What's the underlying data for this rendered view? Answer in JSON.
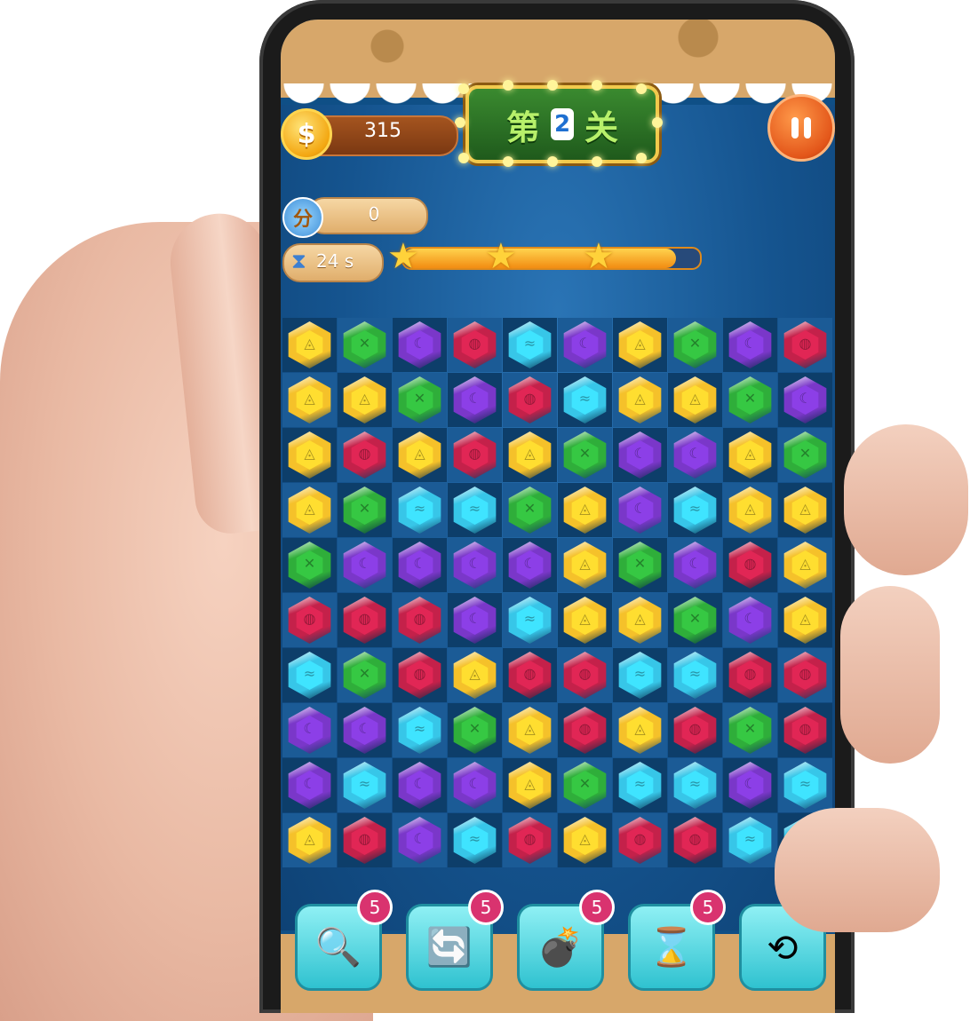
{
  "level": {
    "prefix": "第",
    "number": "2",
    "suffix": "关"
  },
  "coins": {
    "icon": "dollar-coin-icon",
    "symbol": "$",
    "value": "315"
  },
  "pause": {
    "icon": "pause-icon"
  },
  "score": {
    "icon_text": "分",
    "value": "0"
  },
  "timer": {
    "icon": "hourglass-icon",
    "value": "24 s"
  },
  "progress": {
    "fraction": 0.92,
    "star_count": 3
  },
  "board": {
    "rows": 10,
    "cols": 10,
    "gems": [
      [
        "yellow",
        "green",
        "purple",
        "red",
        "cyan",
        "purple",
        "yellow",
        "green",
        "purple",
        "red"
      ],
      [
        "yellow",
        "yellow",
        "green",
        "purple",
        "red",
        "cyan",
        "yellow",
        "yellow",
        "green",
        "purple"
      ],
      [
        "yellow",
        "red",
        "yellow",
        "red",
        "yellow",
        "green",
        "purple",
        "purple",
        "yellow",
        "green"
      ],
      [
        "yellow",
        "green",
        "cyan",
        "cyan",
        "green",
        "yellow",
        "purple",
        "cyan",
        "yellow",
        "yellow"
      ],
      [
        "green",
        "purple",
        "purple",
        "purple",
        "purple",
        "yellow",
        "green",
        "purple",
        "red",
        "yellow"
      ],
      [
        "red",
        "red",
        "red",
        "purple",
        "cyan",
        "yellow",
        "yellow",
        "green",
        "purple",
        "yellow"
      ],
      [
        "cyan",
        "green",
        "red",
        "yellow",
        "red",
        "red",
        "cyan",
        "cyan",
        "red",
        "red"
      ],
      [
        "purple",
        "purple",
        "cyan",
        "green",
        "yellow",
        "red",
        "yellow",
        "red",
        "green",
        "red"
      ],
      [
        "purple",
        "cyan",
        "purple",
        "purple",
        "yellow",
        "green",
        "cyan",
        "cyan",
        "purple",
        "cyan"
      ],
      [
        "yellow",
        "red",
        "purple",
        "cyan",
        "red",
        "yellow",
        "red",
        "red",
        "cyan",
        "cyan"
      ]
    ],
    "colors": {
      "yellow": "#f5c12a",
      "green": "#2fae3a",
      "purple": "#7a37c9",
      "red": "#c4214a",
      "cyan": "#37c6e8"
    }
  },
  "tools": [
    {
      "icon": "magnifier-icon",
      "glyph": "🔍",
      "count": "5"
    },
    {
      "icon": "shuffle-icon",
      "glyph": "🔄",
      "count": "5"
    },
    {
      "icon": "bomb-icon",
      "glyph": "💣",
      "count": "5"
    },
    {
      "icon": "hourglass-freeze-icon",
      "glyph": "⌛",
      "count": "5"
    },
    {
      "icon": "undo-icon",
      "glyph": "⟲",
      "count": ""
    }
  ]
}
